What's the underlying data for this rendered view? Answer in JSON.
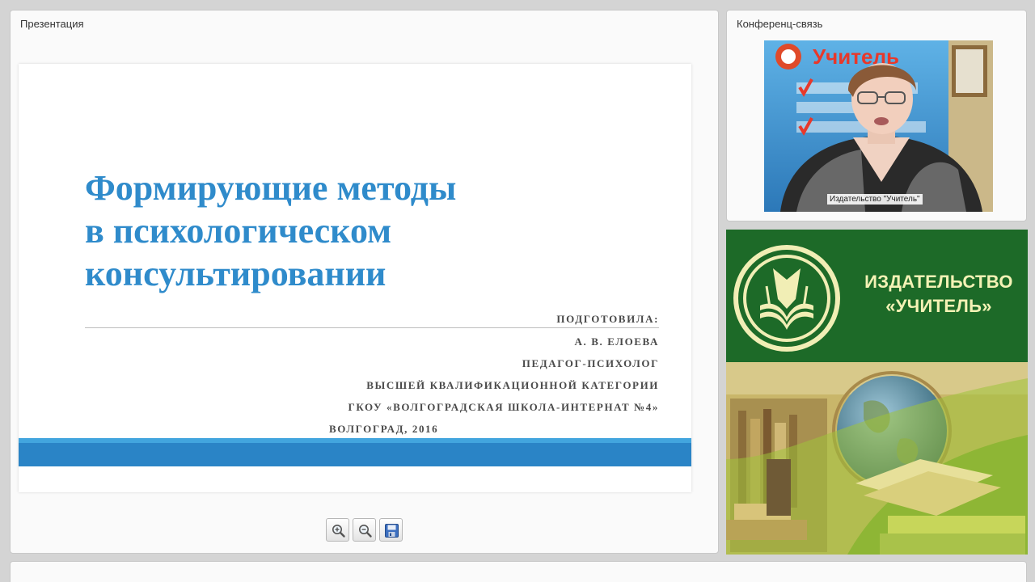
{
  "presentation": {
    "panel_title": "Презентация",
    "slide": {
      "title_lines": [
        "Формирующие методы",
        "в психологическом",
        "консультировании"
      ],
      "prepared_by_label": "ПОДГОТОВИЛА:",
      "author": "А. В. ЕЛОЕВА",
      "position": "ПЕДАГОГ-ПСИХОЛОГ",
      "category": "ВЫСШЕЙ КВАЛИФИКАЦИОННОЙ КАТЕГОРИИ",
      "organization": "ГКОУ «ВОЛГОГРАДСКАЯ ШКОЛА-ИНТЕРНАТ №4»",
      "city_year": "ВОЛГОГРАД, 2016",
      "title_color": "#2f8bcb",
      "band_color": "#2a84c6"
    },
    "toolbar": {
      "zoom_in_icon": "zoom-in-icon",
      "zoom_out_icon": "zoom-out-icon",
      "save_icon": "save-icon"
    }
  },
  "conference": {
    "panel_title": "Конференц-связь",
    "video_label": "Издательство \"Учитель\"",
    "banner_text": "Учитель"
  },
  "ad": {
    "publisher_lines": [
      "ИЗДАТЕЛЬСТВО",
      "«УЧИТЕЛЬ»"
    ],
    "brand_color": "#1d6a28",
    "text_color": "#f4f2b5"
  }
}
